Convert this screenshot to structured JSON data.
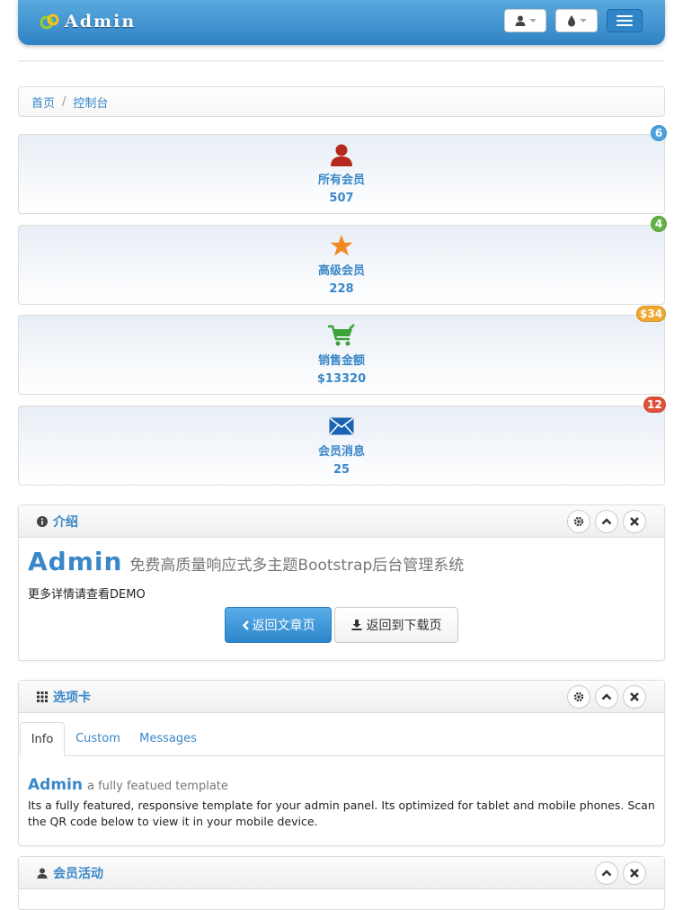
{
  "navbar": {
    "logo_text": "Admin",
    "icons": {
      "user": "user-icon",
      "theme": "tint-icon",
      "menu": "menu-icon"
    }
  },
  "breadcrumb": {
    "home": "首页",
    "current": "控制台"
  },
  "stats": [
    {
      "icon": "user-icon",
      "label": "所有会员",
      "value": "507",
      "badge": "6",
      "badge_color": "#4aa3df"
    },
    {
      "icon": "star-icon",
      "label": "高级会员",
      "value": "228",
      "badge": "4",
      "badge_color": "#62b346"
    },
    {
      "icon": "cart-icon",
      "label": "销售金额",
      "value": "$13320",
      "badge": "$34",
      "badge_color": "#f0a82e"
    },
    {
      "icon": "envelope-icon",
      "label": "会员消息",
      "value": "25",
      "badge": "12",
      "badge_color": "#e0513b"
    }
  ],
  "intro": {
    "title": "介绍",
    "heading": "Admin",
    "subheading": "免费高质量响应式多主题Bootstrap后台管理系统",
    "description": "更多详情请查看DEMO",
    "back_article": "返回文章页",
    "back_download": "返回到下载页"
  },
  "tabs_box": {
    "title": "选项卡",
    "tabs": [
      "Info",
      "Custom",
      "Messages"
    ],
    "active_tab": "Info",
    "content_heading": "Admin",
    "content_subheading": "a fully featued template",
    "content_text": "Its a fully featured, responsive template for your admin panel. Its optimized for tablet and mobile phones. Scan the QR code below to view it in your mobile device."
  },
  "activity": {
    "title": "会员活动"
  },
  "colors": {
    "accent": "#3a87c8",
    "navbar": "#3a8fd0"
  }
}
